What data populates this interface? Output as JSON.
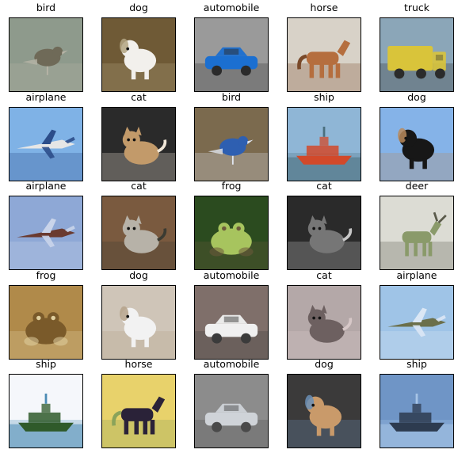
{
  "images": [
    {
      "label": "bird",
      "subject": "bird-icon",
      "palette": [
        "#8e9a8c",
        "#6f6a58",
        "#b7b4a6"
      ]
    },
    {
      "label": "dog",
      "subject": "dog-icon",
      "palette": [
        "#6f5a36",
        "#f2f0ec",
        "#b3a582"
      ]
    },
    {
      "label": "automobile",
      "subject": "car-icon",
      "palette": [
        "#9a9a9a",
        "#1b6fd1",
        "#2b2b2b"
      ]
    },
    {
      "label": "horse",
      "subject": "horse-icon",
      "palette": [
        "#d8d2c8",
        "#b56e3e",
        "#7a4a2a"
      ]
    },
    {
      "label": "truck",
      "subject": "truck-icon",
      "palette": [
        "#8ba6b8",
        "#d9c43a",
        "#2b2b2b"
      ]
    },
    {
      "label": "airplane",
      "subject": "airplane-icon",
      "palette": [
        "#7fb2e6",
        "#e6e6e6",
        "#2c4d8a"
      ]
    },
    {
      "label": "cat",
      "subject": "cat-icon",
      "palette": [
        "#2a2a2a",
        "#c29a6a",
        "#f1e7d8"
      ]
    },
    {
      "label": "bird",
      "subject": "bird-icon",
      "palette": [
        "#7b6a4e",
        "#2e5fb1",
        "#e1e6f0"
      ]
    },
    {
      "label": "ship",
      "subject": "ship-icon",
      "palette": [
        "#8fb6d6",
        "#d2492a",
        "#4b6f7e"
      ]
    },
    {
      "label": "dog",
      "subject": "dog-icon",
      "palette": [
        "#85b3e8",
        "#171717",
        "#b88a5c"
      ]
    },
    {
      "label": "airplane",
      "subject": "airplane-icon",
      "palette": [
        "#8ea8d6",
        "#6a3a2f",
        "#c9d4ea"
      ]
    },
    {
      "label": "cat",
      "subject": "cat-icon",
      "palette": [
        "#7a5a3f",
        "#b7b2a8",
        "#3b3b32"
      ]
    },
    {
      "label": "frog",
      "subject": "frog-icon",
      "palette": [
        "#2b4b1f",
        "#a7c45e",
        "#6d5a3c"
      ]
    },
    {
      "label": "cat",
      "subject": "cat-icon",
      "palette": [
        "#2a2a2a",
        "#767676",
        "#c7c7c7"
      ]
    },
    {
      "label": "deer",
      "subject": "deer-icon",
      "palette": [
        "#dcdcd4",
        "#8a9a6a",
        "#5a5a4a"
      ]
    },
    {
      "label": "frog",
      "subject": "frog-icon",
      "palette": [
        "#b08a4a",
        "#7a5a2a",
        "#e0d0a0"
      ]
    },
    {
      "label": "dog",
      "subject": "dog-icon",
      "palette": [
        "#cfc5b8",
        "#f2f2f2",
        "#b5a28a"
      ]
    },
    {
      "label": "automobile",
      "subject": "car-icon",
      "palette": [
        "#7f6f6a",
        "#f0f0f0",
        "#3b3b3b"
      ]
    },
    {
      "label": "cat",
      "subject": "cat-icon",
      "palette": [
        "#b4a8a8",
        "#6d6060",
        "#d7c8c8"
      ]
    },
    {
      "label": "airplane",
      "subject": "airplane-icon",
      "palette": [
        "#9fc4e7",
        "#6b6f4a",
        "#dbe7f5"
      ]
    },
    {
      "label": "ship",
      "subject": "ship-icon",
      "palette": [
        "#f5f7fb",
        "#2f5a2a",
        "#4b8bb4"
      ]
    },
    {
      "label": "horse",
      "subject": "horse-icon",
      "palette": [
        "#e8d26b",
        "#2a2238",
        "#8aa35a"
      ]
    },
    {
      "label": "automobile",
      "subject": "car-icon",
      "palette": [
        "#8c8c8c",
        "#cfd3d8",
        "#4a4a4a"
      ]
    },
    {
      "label": "dog",
      "subject": "dog-icon",
      "palette": [
        "#3b3a3a",
        "#c99a6a",
        "#6b8fb6"
      ]
    },
    {
      "label": "ship",
      "subject": "ship-icon",
      "palette": [
        "#6f95c6",
        "#2d3b4f",
        "#a6c4e6"
      ]
    }
  ]
}
